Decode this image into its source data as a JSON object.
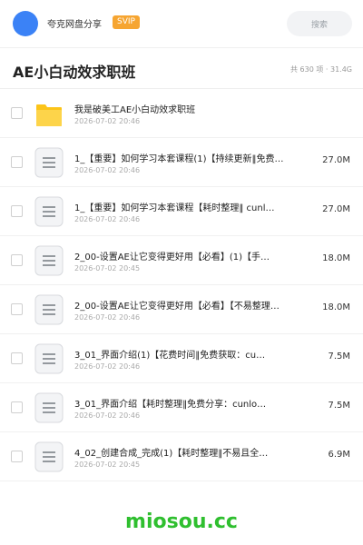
{
  "header": {
    "username": "夸克网盘分享",
    "badge": "SVIP",
    "search_placeholder": "搜索"
  },
  "folder": {
    "title": "AE小白动效求职班",
    "stats": "共 630 项 · 31.4G"
  },
  "files": [
    {
      "name": "我是破美工AE小白动效求职班",
      "date": "2026-07-02 20:46",
      "size": "",
      "icon": "folder-icon"
    },
    {
      "name": "1_【重要】如何学习本套课程(1)【持续更新‖免费…",
      "date": "2026-07-02 20:46",
      "size": "27.0M",
      "icon": "file-icon"
    },
    {
      "name": "1_【重要】如何学习本套课程【耗时整理‖ cunl…",
      "date": "2026-07-02 20:46",
      "size": "27.0M",
      "icon": "file-icon"
    },
    {
      "name": "2_00-设置AE让它变得更好用【必看】(1)【手…",
      "date": "2026-07-02 20:45",
      "size": "18.0M",
      "icon": "file-icon"
    },
    {
      "name": "2_00-设置AE让它变得更好用【必看】【不易整理…",
      "date": "2026-07-02 20:46",
      "size": "18.0M",
      "icon": "file-icon"
    },
    {
      "name": "3_01_界面介绍(1)【花费时间‖免费获取：cu…",
      "date": "2026-07-02 20:46",
      "size": "7.5M",
      "icon": "file-icon"
    },
    {
      "name": "3_01_界面介绍【耗时整理‖免费分享：cunlo…",
      "date": "2026-07-02 20:46",
      "size": "7.5M",
      "icon": "file-icon"
    },
    {
      "name": "4_02_创建合成_完成(1)【耗时整理‖不易且全…",
      "date": "2026-07-02 20:45",
      "size": "6.9M",
      "icon": "file-icon"
    }
  ],
  "watermark": "miosou.cc",
  "colors": {
    "avatar": "#3b82f6",
    "svip_badge": "#f6a531",
    "folder": "#fcc419",
    "watermark": "#2fbf2f"
  }
}
